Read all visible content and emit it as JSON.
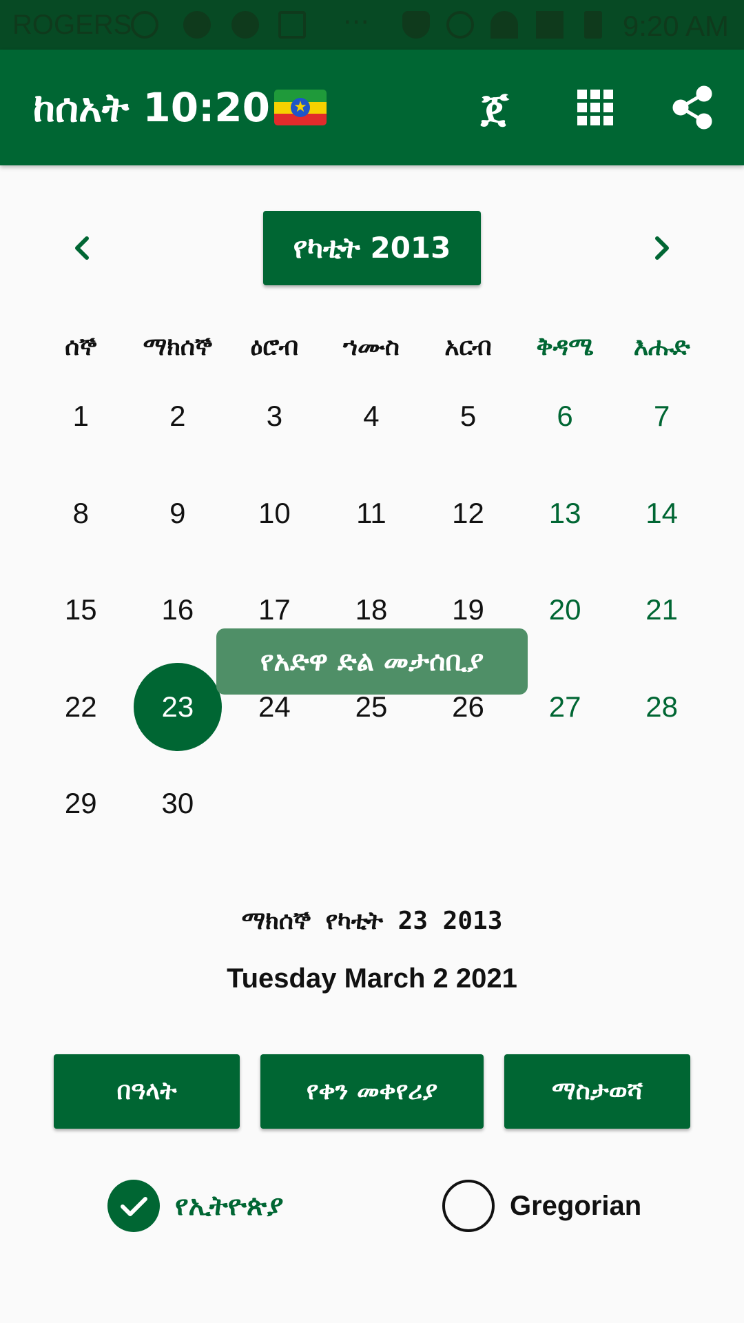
{
  "status_bar": {
    "carrier": "ROGERS",
    "time": "9:20 AM",
    "more": "···"
  },
  "app_bar": {
    "title": "ከሰአት 10:20",
    "flag_icon": "ethiopian-flag",
    "ethiopic_glyph": "ጀ",
    "grid_icon": "apps-grid-icon",
    "share_icon": "share-icon"
  },
  "calendar": {
    "month_label": "የካቲት 2013",
    "weekdays": [
      "ሰኞ",
      "ማክሰኞ",
      "ዕሮብ",
      "ኀሙስ",
      "አርብ",
      "ቅዳሜ",
      "እሑድ"
    ],
    "days": [
      "1",
      "2",
      "3",
      "4",
      "5",
      "6",
      "7",
      "8",
      "9",
      "10",
      "11",
      "12",
      "13",
      "14",
      "15",
      "16",
      "17",
      "18",
      "19",
      "20",
      "21",
      "22",
      "23",
      "24",
      "25",
      "26",
      "27",
      "28",
      "29",
      "30"
    ],
    "selected_day": "23",
    "weekend_color": "#006633",
    "holiday_tooltip": "የአድዋ ድል መታሰቢያ"
  },
  "selected_date": {
    "ethiopian": "ማክሰኞ የካቲት 23 2013",
    "gregorian": "Tuesday March 2 2021"
  },
  "actions": {
    "holidays": "በዓላት",
    "converter": "የቀን መቀየሪያ",
    "reminder": "ማስታወሻ"
  },
  "calendar_type": {
    "ethiopian_label": "የኢትዮጵያ",
    "gregorian_label": "Gregorian",
    "selected": "ethiopian"
  },
  "colors": {
    "primary": "#006633",
    "tooltip": "#4f8f67"
  }
}
